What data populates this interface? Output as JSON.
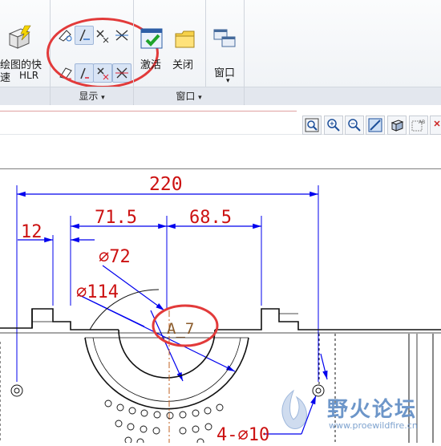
{
  "ribbon": {
    "hlr_label_line1": "绘图的快",
    "hlr_label_line2": "速",
    "hlr_label_sub": "HLR",
    "activate_label": "激活",
    "close_label": "关闭",
    "window_btn_label": "窗口",
    "group_display": "显示",
    "group_window": "窗口",
    "dropdown_arrow": "▾"
  },
  "drawing": {
    "dim_220": "220",
    "dim_71_5": "71.5",
    "dim_68_5": "68.5",
    "dim_12": "12",
    "dim_phi72": "∅72",
    "dim_phi114": "∅114",
    "dim_4phi10": "4-∅10",
    "datum": "A_7"
  },
  "watermark": {
    "text": "野火论坛",
    "url": "www.proewildfire.cn"
  },
  "colors": {
    "dimension_red": "#cc1111",
    "arrow_blue": "#0000ee",
    "highlight_ring": "#e23a3a"
  }
}
